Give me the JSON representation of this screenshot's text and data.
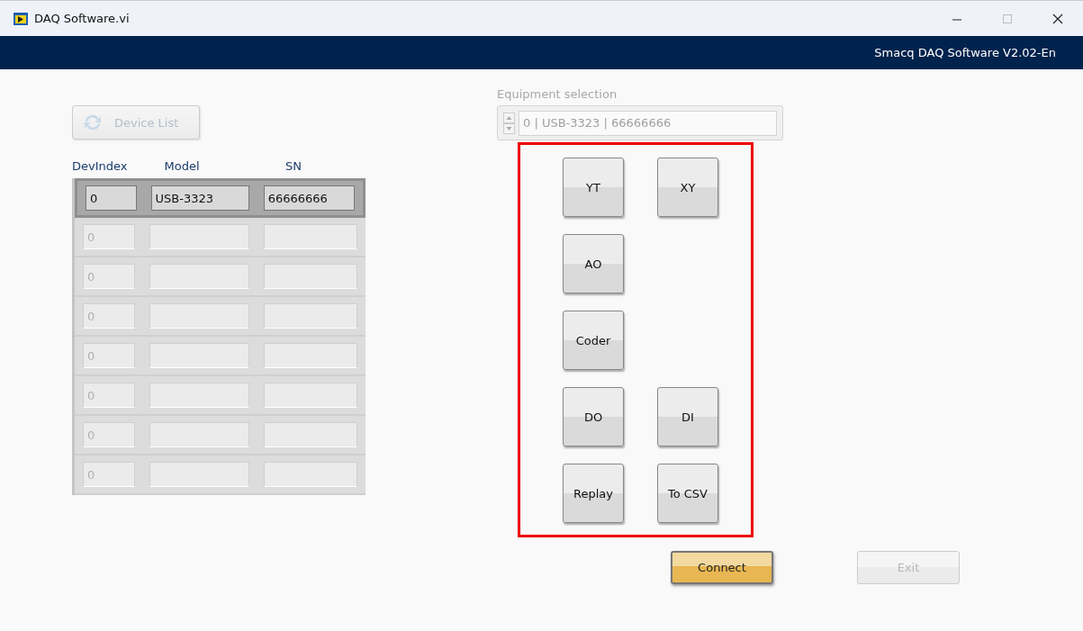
{
  "window": {
    "title": "DAQ Software.vi"
  },
  "banner": {
    "text": "Smacq DAQ Software V2.02-En"
  },
  "device_list_button": {
    "label": "Device List",
    "disabled": true
  },
  "table": {
    "columns": [
      "DevIndex",
      "Model",
      "SN"
    ],
    "rows": [
      {
        "cells": [
          "0",
          "USB-3323",
          "66666666"
        ],
        "selected": true
      },
      {
        "cells": [
          "0",
          "",
          ""
        ],
        "selected": false
      },
      {
        "cells": [
          "0",
          "",
          ""
        ],
        "selected": false
      },
      {
        "cells": [
          "0",
          "",
          ""
        ],
        "selected": false
      },
      {
        "cells": [
          "0",
          "",
          ""
        ],
        "selected": false
      },
      {
        "cells": [
          "0",
          "",
          ""
        ],
        "selected": false
      },
      {
        "cells": [
          "0",
          "",
          ""
        ],
        "selected": false
      },
      {
        "cells": [
          "0",
          "",
          ""
        ],
        "selected": false
      }
    ]
  },
  "equipment_selection": {
    "label": "Equipment selection",
    "value": "0 | USB-3323 | 66666666",
    "disabled": true
  },
  "function_buttons": [
    [
      "YT",
      "XY"
    ],
    [
      "AO"
    ],
    [
      "Coder"
    ],
    [
      "DO",
      "DI"
    ],
    [
      "Replay",
      "To CSV"
    ]
  ],
  "actions": [
    {
      "label": "Connect",
      "default": true,
      "disabled": false
    },
    {
      "label": "Exit",
      "default": false,
      "disabled": true
    }
  ]
}
